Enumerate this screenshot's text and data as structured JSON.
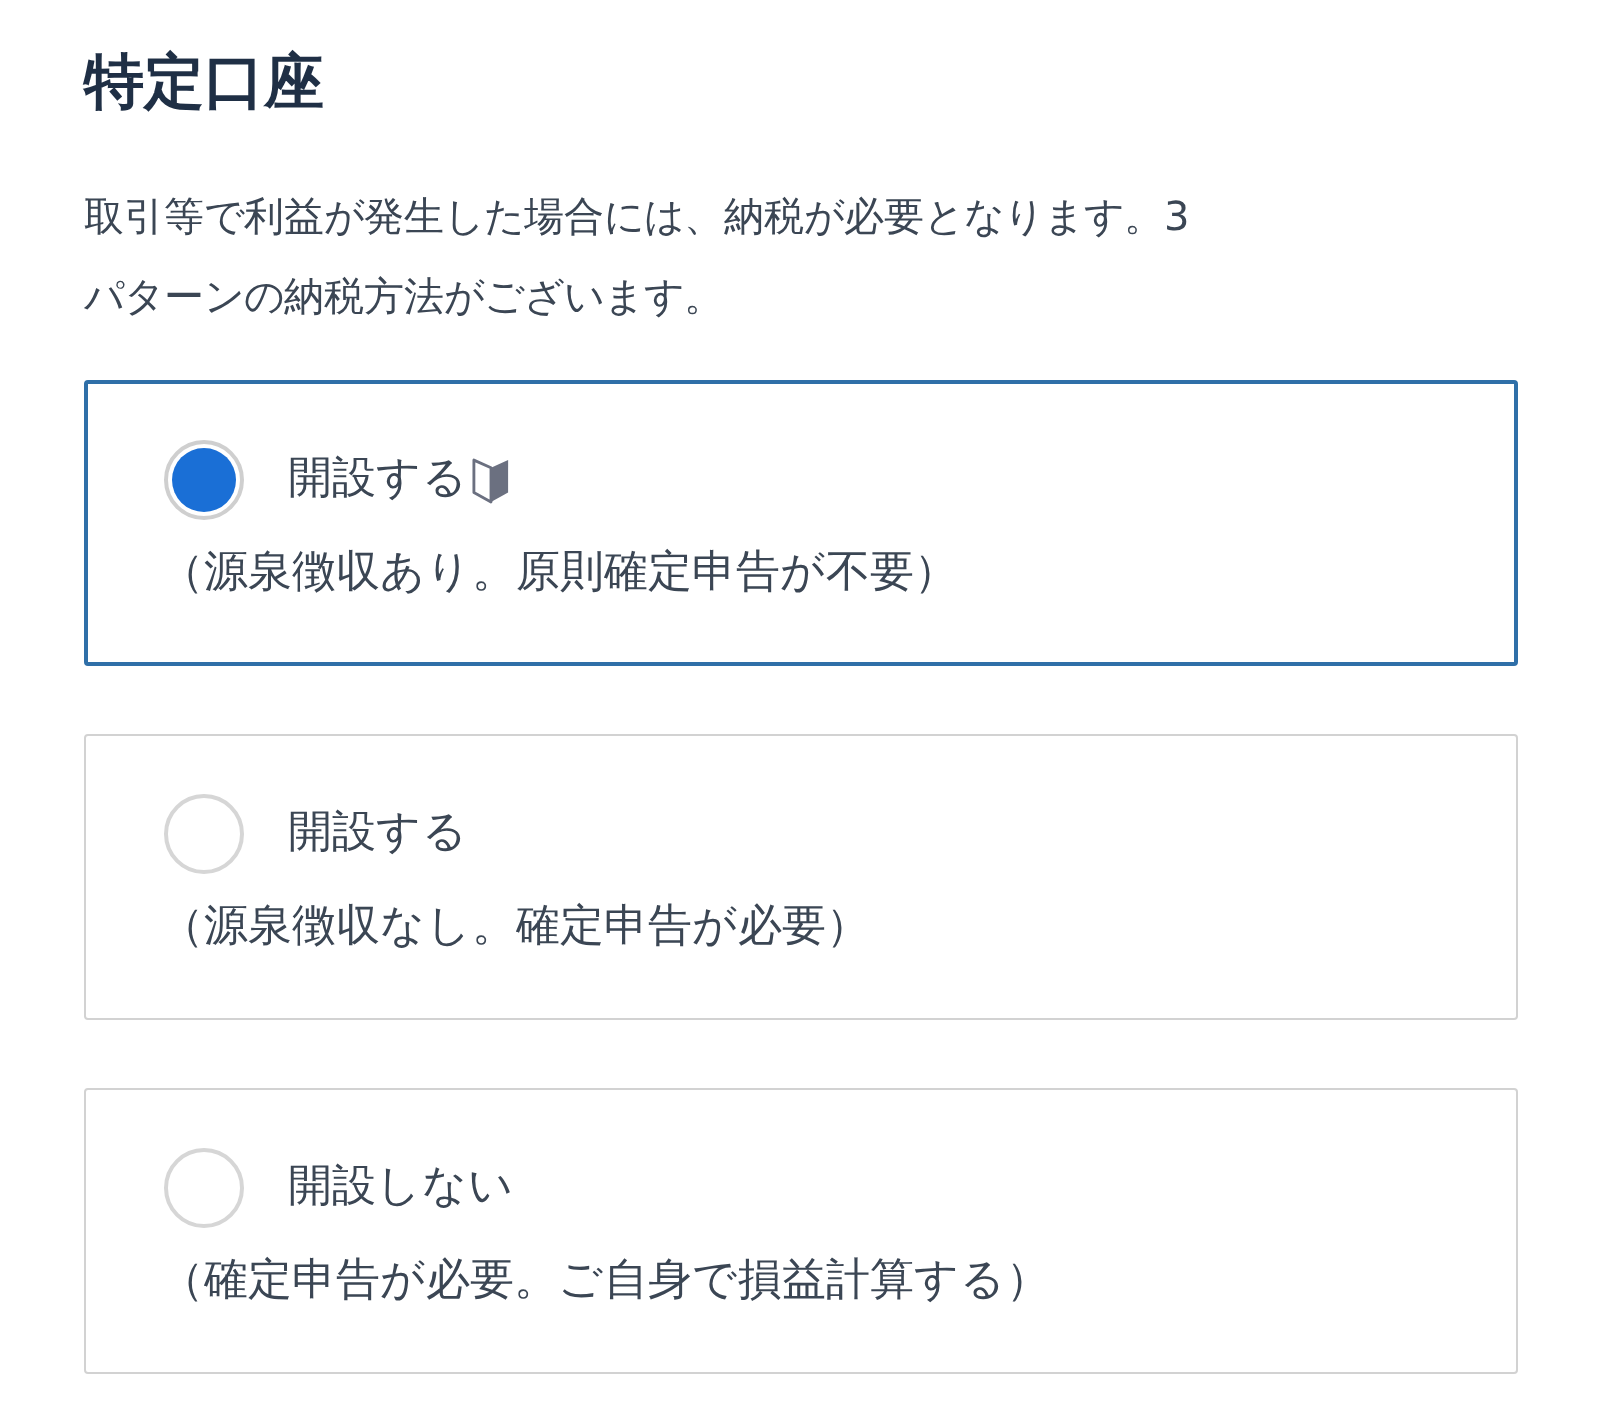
{
  "title": "特定口座",
  "description": "取引等で利益が発生した場合には、納税が必要となります。3パターンの納税方法がございます。",
  "options": [
    {
      "label": "開設する",
      "note": "（源泉徴収あり。原則確定申告が不要）",
      "selected": true,
      "beginner_mark": true
    },
    {
      "label": "開設する",
      "note": "（源泉徴収なし。確定申告が必要）",
      "selected": false,
      "beginner_mark": false
    },
    {
      "label": "開設しない",
      "note": "（確定申告が必要。ご自身で損益計算する）",
      "selected": false,
      "beginner_mark": false
    }
  ]
}
